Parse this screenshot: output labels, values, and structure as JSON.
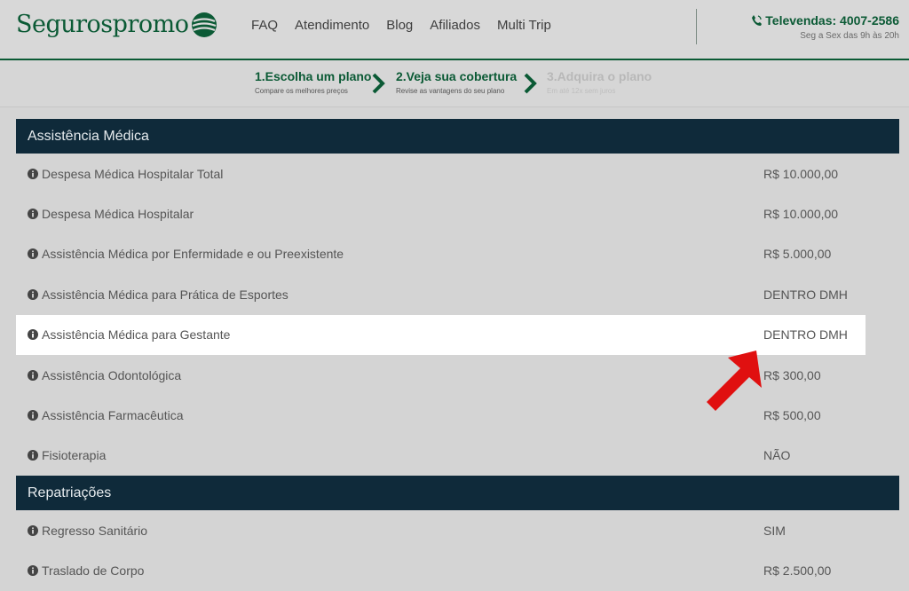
{
  "header": {
    "logo_text": "Segurospromo",
    "nav": [
      "FAQ",
      "Atendimento",
      "Blog",
      "Afiliados",
      "Multi Trip"
    ],
    "phone": "Televendas: 4007-2586",
    "hours": "Seg a Sex das 9h às 20h"
  },
  "steps": [
    {
      "title": "1.Escolha um plano",
      "subtitle": "Compare os melhores preços"
    },
    {
      "title": "2.Veja sua cobertura",
      "subtitle": "Revise as vantagens do seu plano"
    },
    {
      "title": "3.Adquira o plano",
      "subtitle": "Em até 12x sem juros"
    }
  ],
  "sections": [
    {
      "title": "Assistência Médica",
      "rows": [
        {
          "label": "Despesa Médica Hospitalar Total",
          "value": "R$ 10.000,00"
        },
        {
          "label": "Despesa Médica Hospitalar",
          "value": "R$ 10.000,00"
        },
        {
          "label": "Assistência Médica por Enfermidade e ou Preexistente",
          "value": "R$ 5.000,00"
        },
        {
          "label": "Assistência Médica para Prática de Esportes",
          "value": "DENTRO DMH"
        },
        {
          "label": "Assistência Médica para Gestante",
          "value": "DENTRO DMH"
        },
        {
          "label": "Assistência Odontológica",
          "value": "R$ 300,00"
        },
        {
          "label": "Assistência Farmacêutica",
          "value": "R$ 500,00"
        },
        {
          "label": "Fisioterapia",
          "value": "NÃO"
        }
      ]
    },
    {
      "title": "Repatriações",
      "rows": [
        {
          "label": "Regresso Sanitário",
          "value": "SIM"
        },
        {
          "label": "Traslado de Corpo",
          "value": "R$ 2.500,00"
        }
      ]
    }
  ],
  "colors": {
    "brand_green": "#0b5a35",
    "section_header": "#0f2a3a",
    "highlight_arrow": "#e01010"
  }
}
